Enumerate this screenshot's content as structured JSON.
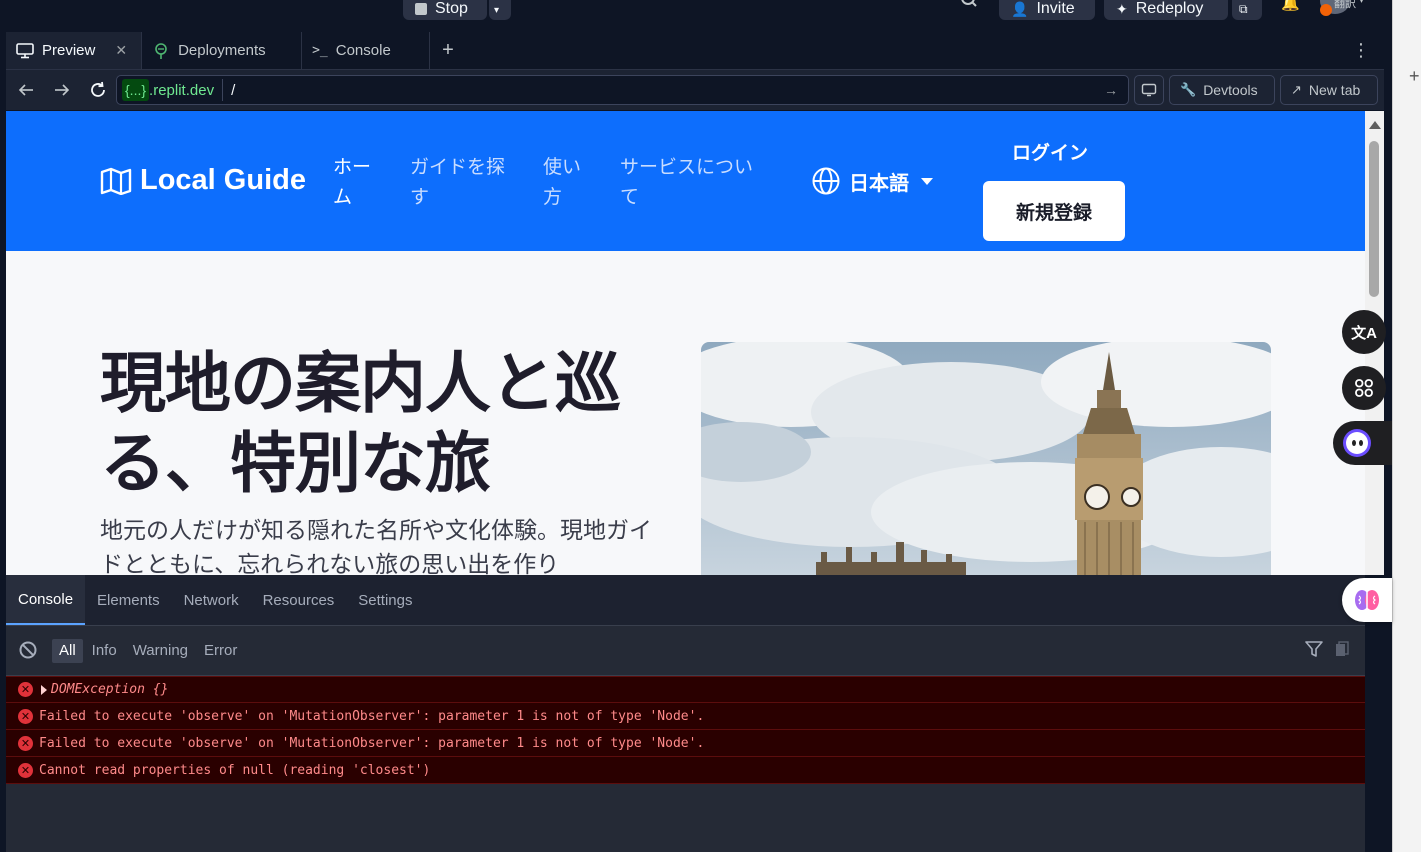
{
  "topbar": {
    "stop_label": "Stop",
    "invite_label": "Invite",
    "redeploy_label": "Redeploy",
    "lang_badge": "翻訳"
  },
  "tabs": [
    {
      "label": "Preview",
      "icon": "monitor-icon",
      "active": true
    },
    {
      "label": "Deployments",
      "icon": "deploy-icon",
      "active": false
    },
    {
      "label": "Console",
      "icon": "terminal-icon",
      "active": false
    }
  ],
  "url": {
    "host_badge": "{...}",
    "host_rest": ".replit.dev",
    "path": "/"
  },
  "url_actions": {
    "devtools_label": "Devtools",
    "newtab_label": "New tab"
  },
  "site": {
    "logo_text": "Local Guide",
    "nav": [
      {
        "line1": "ホー",
        "line2": "ム"
      },
      {
        "line1": "ガイドを探",
        "line2": "す"
      },
      {
        "line1": "使い",
        "line2": "方"
      },
      {
        "line1": "サービスについ",
        "line2": "て"
      }
    ],
    "language": "日本語",
    "login": "ログイン",
    "signup": "新規登録",
    "hero_title": "現地の案内人と巡る、特別な旅",
    "hero_desc": "地元の人だけが知る隠れた名所や文化体験。現地ガイドとともに、忘れられない旅の思い出を作り"
  },
  "devtools": {
    "tabs": [
      "Console",
      "Elements",
      "Network",
      "Resources",
      "Settings"
    ],
    "levels": [
      "All",
      "Info",
      "Warning",
      "Error"
    ],
    "logs": [
      {
        "text": "DOMException {}",
        "expandable": true
      },
      {
        "text": "Failed to execute 'observe' on 'MutationObserver': parameter 1 is not of type 'Node'.",
        "expandable": false
      },
      {
        "text": "Failed to execute 'observe' on 'MutationObserver': parameter 1 is not of type 'Node'.",
        "expandable": false
      },
      {
        "text": "Cannot read properties of null (reading 'closest')",
        "expandable": false
      }
    ]
  },
  "colors": {
    "brand": "#0d6efd",
    "error_bg": "#2a0000",
    "error_text": "#ff8a8a",
    "url_green": "#6fe891"
  }
}
